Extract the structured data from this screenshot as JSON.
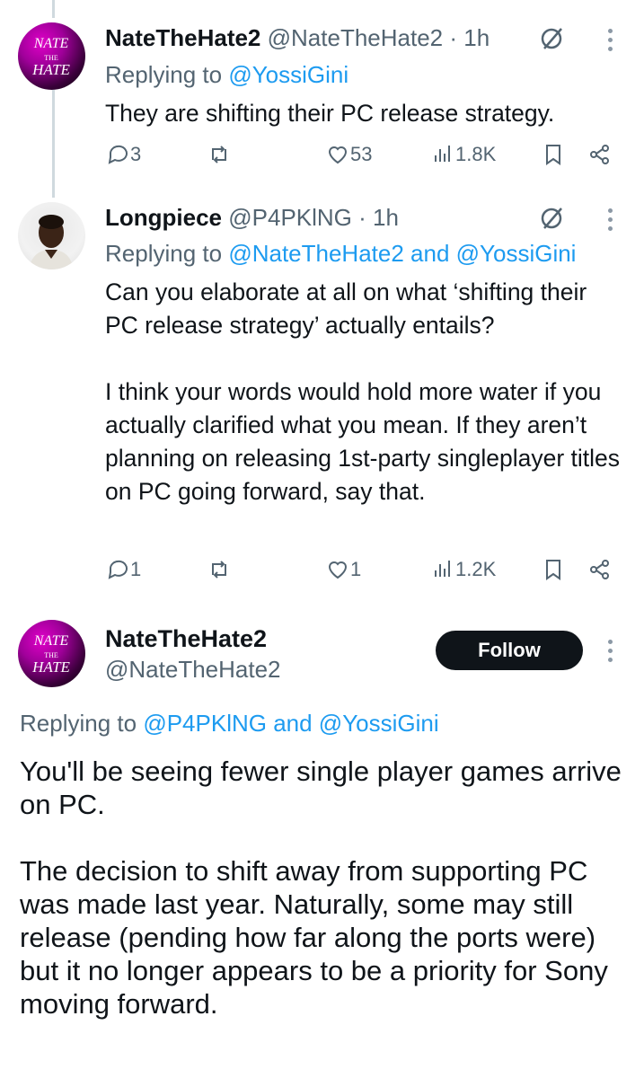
{
  "reply1": {
    "name": "NateTheHate2",
    "handle": "@NateTheHate2",
    "time": "· 1h",
    "replying_prefix": "Replying to ",
    "replying_to": "@YossiGini",
    "text": "They are shifting their PC release strategy.",
    "replies": "3",
    "likes": "53",
    "views": "1.8K",
    "avatar_text": "NATE THE HATE"
  },
  "reply2": {
    "name": "Longpiece",
    "handle": "@P4PKlNG",
    "time": "· 1h",
    "replying_prefix": "Replying to ",
    "replying_to": "@NateTheHate2 and @YossiGini",
    "text": "Can you elaborate at all on what ‘shifting their PC release strategy’ actually entails?\n\nI think your words would hold more water if you actually clarified what you mean. If they aren’t planning on releasing 1st-party singleplayer titles on PC going forward, say that.",
    "replies": "1",
    "likes": "1",
    "views": "1.2K"
  },
  "main": {
    "name": "NateTheHate2",
    "handle": "@NateTheHate2",
    "follow_label": "Follow",
    "replying_prefix": "Replying to ",
    "replying_to": "@P4PKlNG and @YossiGini",
    "text": "You'll be seeing fewer single player games arrive on PC.\n\nThe decision to shift away from supporting PC was made last year. Naturally, some may still release (pending how far along the ports were) but it no longer appears to be a priority for Sony moving forward.",
    "avatar_text": "NATE THE HATE"
  },
  "colors": {
    "link": "#1d9bf0",
    "secondary_text": "#536471",
    "thread_line": "#cfd9de",
    "brand_pink": "#e000c8"
  }
}
